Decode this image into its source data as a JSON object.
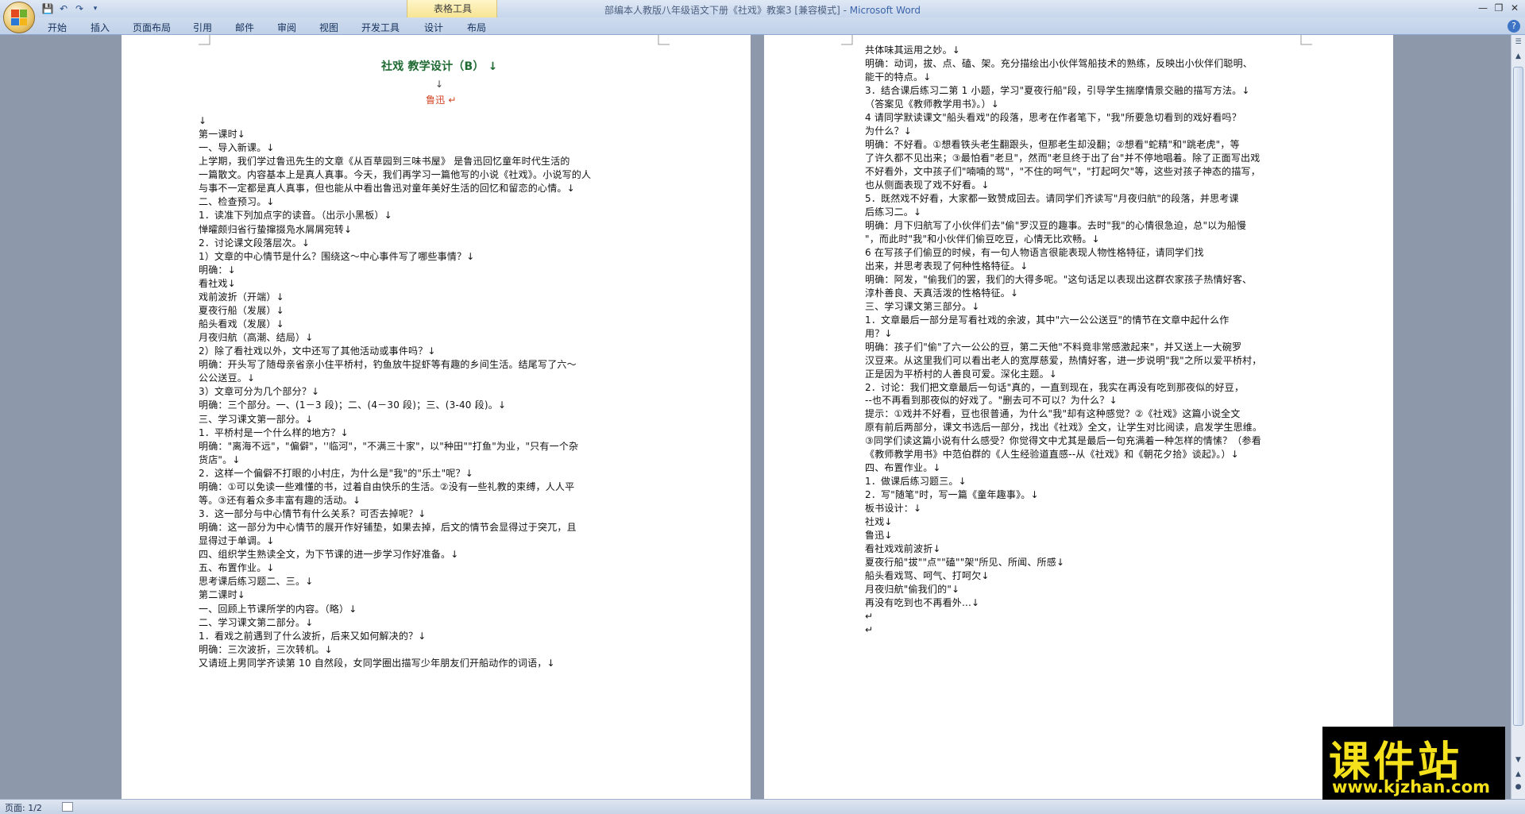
{
  "window": {
    "title": "部编本人教版八年级语文下册《社戏》教案3 [兼容模式] - Microsoft Word",
    "context_tab_title": "表格工具"
  },
  "ribbon": {
    "tabs": [
      "开始",
      "插入",
      "页面布局",
      "引用",
      "邮件",
      "审阅",
      "视图",
      "开发工具",
      "设计",
      "布局"
    ]
  },
  "status_bar": {
    "page_info": "页面: 1/2"
  },
  "watermark": {
    "main": "课件站",
    "url": "www.kjzhan.com"
  },
  "document": {
    "page1": {
      "title": "社戏  教学设计（B） ↓",
      "blank_mark": "↓",
      "author": "鲁迅 ↵",
      "lines": [
        "↓",
        "第一课时↓",
        "一、导入新课。↓",
        "上学期，我们学过鲁迅先生的文章《从百草园到三味书屋》 是鲁迅回忆童年时代生活的",
        "一篇散文。内容基本上是真人真事。今天，我们再学习一篇他写的小说《社戏》。小说写的人",
        "与事不一定都是真人真事，但也能从中看出鲁迅对童年美好生活的回忆和留恋的心情。↓",
        "二、检查预习。↓",
        "  1．读准下列加点字的读音。（出示小黑板）↓",
        "惮曤颇归省行蛰撺掇凫水屑屑宛转↓",
        "  2．讨论课文段落层次。↓",
        "  1）文章的中心情节是什么？围绕这～中心事件写了哪些事情？↓",
        "明确：↓",
        "看社戏↓",
        "戏前波折（开端）↓",
        "夏夜行船（发展）↓",
        "船头看戏（发展）↓",
        "月夜归航（高潮、结局）↓",
        "  2）除了看社戏以外，文中还写了其他活动或事件吗？↓",
        "明确：开头写了随母亲省亲小住平桥村，钓鱼放牛捉虾等有趣的乡间生活。结尾写了六～",
        "公公送豆。↓",
        "  3）文章可分为几个部分？↓",
        "明确：三个部分。一、(1－3 段)；二、(4－30 段)；三、(3-40 段)。↓",
        "三、学习课文第一部分。↓",
        "  1．平桥村是一个什么样的地方？↓",
        "明确：\"离海不远\"，\"偏僻\"，''临河\"，\"不满三十家\"，以\"种田\"\"打鱼\"为业，\"只有一个杂",
        "货店\"。↓",
        "  2．这样一个偏僻不打眼的小村庄，为什么是\"我\"的\"乐土\"呢？↓",
        "明确：①可以免读一些难懂的书，过着自由快乐的生活。②没有一些礼教的束缚，人人平",
        "等。③还有着众多丰富有趣的活动。↓",
        "  3．这一部分与中心情节有什么关系？可否去掉呢？↓",
        "明确：这一部分为中心情节的展开作好铺垫，如果去掉，后文的情节会显得过于突兀，且",
        "显得过于单调。↓",
        "四、组织学生熟读全文，为下节课的进一步学习作好准备。↓",
        "五、布置作业。↓",
        "思考课后练习题二、三。↓",
        "第二课时↓",
        "一、回顾上节课所学的内容。（略）↓",
        "二、学习课文第二部分。↓",
        "  1．看戏之前遇到了什么波折，后来又如何解决的？↓",
        "明确：三次波折，三次转机。↓",
        "又请班上男同学齐读第 10 自然段，女同学圈出描写少年朋友们开船动作的词语，↓"
      ]
    },
    "page2": {
      "lines": [
        "共体味其运用之妙。↓",
        "明确：动词，拔、点、磕、架。充分描绘出小伙伴驾船技术的熟练，反映出小伙伴们聪明、",
        "能干的特点。↓",
        "  3．结合课后练习二第 1 小题，学习\"夏夜行船\"段，引导学生揣摩情景交融的描写方法。↓",
        "（答案见《教师教学用书》。）↓",
        "  4 请同学默读课文\"船头看戏\"的段落，思考在作者笔下，\"我\"所要急切看到的戏好看吗？",
        "为什么？↓",
        "明确：不好看。①想看铁头老生翻跟头，但那老生却没翻；②想看\"蛇精\"和\"跳老虎\"，等",
        "了许久都不见出来；③最怕看\"老旦\"，然而\"老旦终于出了台\"并不停地唱着。除了正面写出戏",
        "不好看外，文中孩子们\"喃喃的骂\"，\"不住的呵气\"，\"打起呵欠\"等，这些对孩子神态的描写，",
        "也从侧面表现了戏不好看。↓",
        "  5．既然戏不好看，大家都一致赞成回去。请同学们齐读写\"月夜归航\"的段落，并思考课",
        "后练习二。↓",
        "明确：月下归航写了小伙伴们去\"偷\"罗汉豆的趣事。去时\"我\"的心情很急迫，总\"以为船慢",
        "\"，而此时\"我\"和小伙伴们偷豆吃豆，心情无比欢畅。↓",
        "  6 在写孩子们偷豆的时候，有一句人物语言很能表现人物性格特征，请同学们找",
        "出来，并思考表现了何种性格特征。↓",
        "明确：阿发，\"偷我们的罢，我们的大得多呢。\"这句话足以表现出这群农家孩子热情好客、",
        "淳朴善良、天真活泼的性格特征。↓",
        "三、学习课文第三部分。↓",
        "  1．文章最后一部分是写看社戏的余波，其中\"六一公公送豆\"的情节在文章中起什么作",
        "用？↓",
        "明确：孩子们\"偷\"了六一公公的豆，第二天他\"不料竟非常感激起来\"，并又送上一大碗罗",
        "汉豆来。从这里我们可以看出老人的宽厚慈爱，热情好客，进一步说明\"我\"之所以爱平桥村，",
        "正是因为平桥村的人善良可爱。深化主题。↓",
        "  2．讨论：我们把文章最后一句话\"真的，一直到现在，我实在再没有吃到那夜似的好豆，",
        "--也不再看到那夜似的好戏了。\"删去可不可以？为什么？↓",
        "提示：①戏并不好看，豆也很普通，为什么\"我\"却有这种感觉？②《社戏》这篇小说全文",
        "原有前后两部分，课文书选后一部分，找出《社戏》全文，让学生对比阅读，启发学生思维。",
        "③同学们读这篇小说有什么感受？你觉得文中尤其是最后一句充满着一种怎样的情愫？（参看",
        "《教师教学用书》中范伯群的《人生经验道直感--从《社戏》和《朝花夕拾》谈起》。）↓",
        "四、布置作业。↓",
        "  1．做课后练习题三。↓",
        "  2．写\"随笔\"时，写一篇《童年趣事》。↓",
        "板书设计：↓",
        "社戏↓",
        "鲁迅↓",
        "看社戏戏前波折↓",
        "夏夜行船\"拔\"\"点\"\"磕\"\"架\"所见、所闻、所感↓",
        "船头看戏骂、呵气、打呵欠↓",
        "月夜归航\"偷我们的\"↓",
        "再没有吃到也不再看外...↓",
        "  ↵",
        "↵"
      ]
    }
  }
}
